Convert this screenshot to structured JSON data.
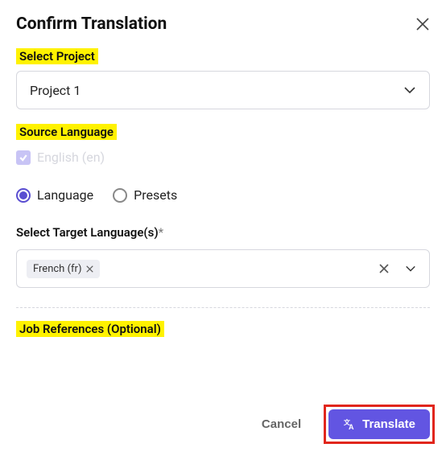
{
  "title": "Confirm Translation",
  "labels": {
    "select_project": "Select Project",
    "source_language": "Source Language",
    "target_lang_header": "Select Target Language(s)",
    "required_mark": "*",
    "job_references": "Job References (Optional)"
  },
  "project_select": {
    "value": "Project 1"
  },
  "source": {
    "checked": true,
    "text": "English (en)"
  },
  "mode": {
    "selected": "language",
    "options": {
      "language": "Language",
      "presets": "Presets"
    }
  },
  "target_select": {
    "chips": [
      {
        "label": "French (fr)"
      }
    ]
  },
  "footer": {
    "cancel": "Cancel",
    "translate": "Translate"
  }
}
